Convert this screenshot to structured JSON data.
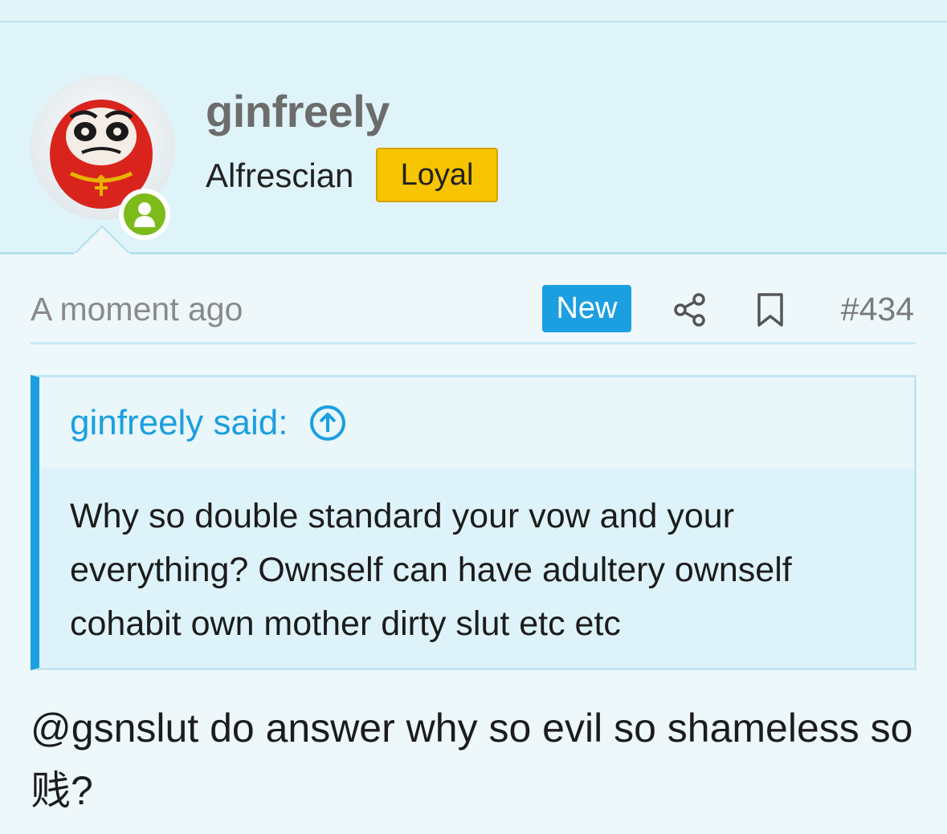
{
  "user": {
    "name": "ginfreely",
    "title": "Alfrescian",
    "badge": "Loyal",
    "avatar_icon": "daruma-avatar",
    "online_icon": "user-online-icon"
  },
  "post": {
    "time": "A moment ago",
    "new_label": "New",
    "share_icon": "share-icon",
    "bookmark_icon": "bookmark-icon",
    "number": "#434",
    "quote": {
      "author": "ginfreely said:",
      "jump_icon": "arrow-up-circle-icon",
      "text": "Why so double standard your vow and your everything? Ownself can have adultery ownself cohabit own mother dirty slut etc etc"
    },
    "message": "@gsnslut do answer why so evil so shameless so 贱?"
  },
  "colors": {
    "accent": "#1b9fe0",
    "badge": "#f6c400",
    "online": "#7dbb1a",
    "header_bg": "#dff4f9",
    "page_bg": "#eef8fb"
  }
}
